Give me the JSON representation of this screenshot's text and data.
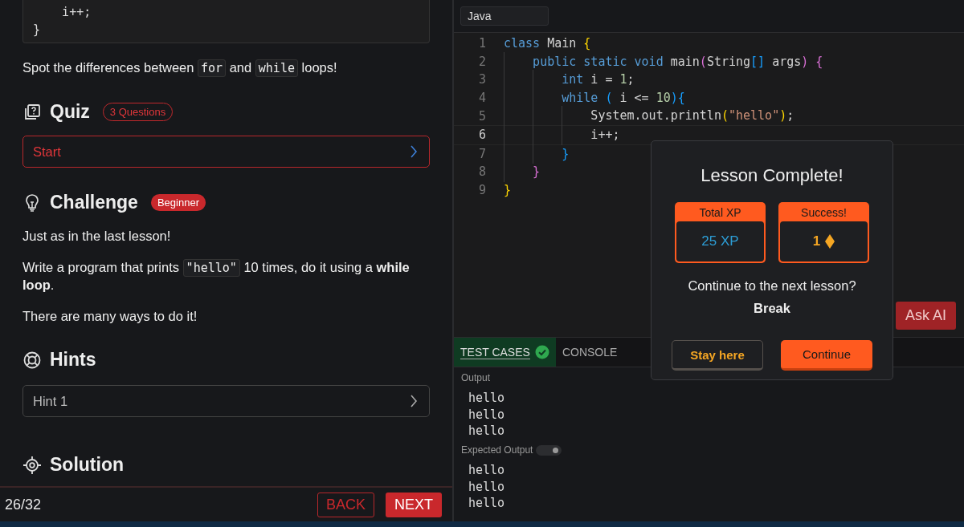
{
  "lesson": {
    "code_snippet": [
      "    i++;",
      "}"
    ],
    "intro": [
      {
        "text": "Spot the differences between "
      },
      {
        "text": "for",
        "kind": "code"
      },
      {
        "text": " and "
      },
      {
        "text": "while",
        "kind": "code"
      },
      {
        "text": " loops!"
      }
    ],
    "quiz": {
      "title": "Quiz",
      "badge": "3 Questions",
      "start": "Start"
    },
    "challenge": {
      "title": "Challenge",
      "badge": "Beginner",
      "paragraphs": [
        [
          {
            "text": "Just as in the last lesson!"
          }
        ],
        [
          {
            "text": "Write a program that prints "
          },
          {
            "text": "\"hello\"",
            "kind": "code"
          },
          {
            "text": " 10 times, do it using a **while loop**."
          }
        ],
        [
          {
            "text": "There are many ways to do it!"
          }
        ]
      ]
    },
    "hints": {
      "title": "Hints",
      "items": [
        "Hint 1"
      ]
    },
    "solution": {
      "title": "Solution"
    }
  },
  "footer": {
    "progress": "26/32",
    "back": "BACK",
    "next": "NEXT"
  },
  "editor": {
    "language": "Java",
    "lines": [
      {
        "number": "1",
        "current": false,
        "tokens": [
          {
            "text": "class",
            "color": "#569cd6"
          },
          {
            "text": " Main "
          },
          {
            "text": "{",
            "color": "#ffd700"
          }
        ]
      },
      {
        "number": "2",
        "current": false,
        "tokens": [
          {
            "text": "    public static void",
            "color": "#569cd6"
          },
          {
            "text": " main"
          },
          {
            "text": "(",
            "color": "#da70d6"
          },
          {
            "text": "String"
          },
          {
            "text": "[]",
            "color": "#179fff"
          },
          {
            "text": " args"
          },
          {
            "text": ") ",
            "color": "#da70d6"
          },
          {
            "text": "{",
            "color": "#da70d6"
          }
        ]
      },
      {
        "number": "3",
        "current": false,
        "tokens": [
          {
            "text": "        int",
            "color": "#569cd6"
          },
          {
            "text": " i = "
          },
          {
            "text": "1",
            "color": "#b5cea8"
          },
          {
            "text": ";"
          }
        ]
      },
      {
        "number": "4",
        "current": false,
        "tokens": [
          {
            "text": "        while",
            "color": "#569cd6"
          },
          {
            "text": " ( ",
            "color": "#179fff"
          },
          {
            "text": "i <= "
          },
          {
            "text": "10",
            "color": "#b5cea8"
          },
          {
            "text": "){",
            "color": "#179fff"
          }
        ]
      },
      {
        "number": "5",
        "current": false,
        "tokens": [
          {
            "text": "            System.out.println"
          },
          {
            "text": "(",
            "color": "#ffd700"
          },
          {
            "text": "\"hello\"",
            "color": "#ce9178"
          },
          {
            "text": ")",
            "color": "#ffd700"
          },
          {
            "text": ";"
          }
        ]
      },
      {
        "number": "6",
        "current": true,
        "tokens": [
          {
            "text": "            i++;"
          }
        ]
      },
      {
        "number": "7",
        "current": false,
        "tokens": [
          {
            "text": "        }",
            "color": "#179fff"
          }
        ]
      },
      {
        "number": "8",
        "current": false,
        "tokens": [
          {
            "text": "    }",
            "color": "#da70d6"
          }
        ]
      },
      {
        "number": "9",
        "current": false,
        "tokens": [
          {
            "text": "}",
            "color": "#ffd700"
          }
        ]
      }
    ],
    "ask_ai": "Ask AI"
  },
  "panel": {
    "tabs": [
      {
        "label": "TEST CASES",
        "selected": true,
        "passed": true
      },
      {
        "label": "CONSOLE",
        "selected": false,
        "passed": false
      }
    ],
    "output": {
      "label": "Output",
      "lines": [
        "hello",
        "hello",
        "hello"
      ]
    },
    "expected": {
      "label": "Expected Output",
      "on": true,
      "lines": [
        "hello",
        "hello",
        "hello"
      ]
    }
  },
  "dialog": {
    "title": "Lesson Complete!",
    "stats": [
      {
        "label": "Total XP",
        "value": "25",
        "unit": "XP",
        "kind": "xp"
      },
      {
        "label": "Success!",
        "value": "1",
        "kind": "gems"
      }
    ],
    "question": "Continue to the next lesson?",
    "note": "Break",
    "stay": "Stay here",
    "continue": "Continue"
  }
}
